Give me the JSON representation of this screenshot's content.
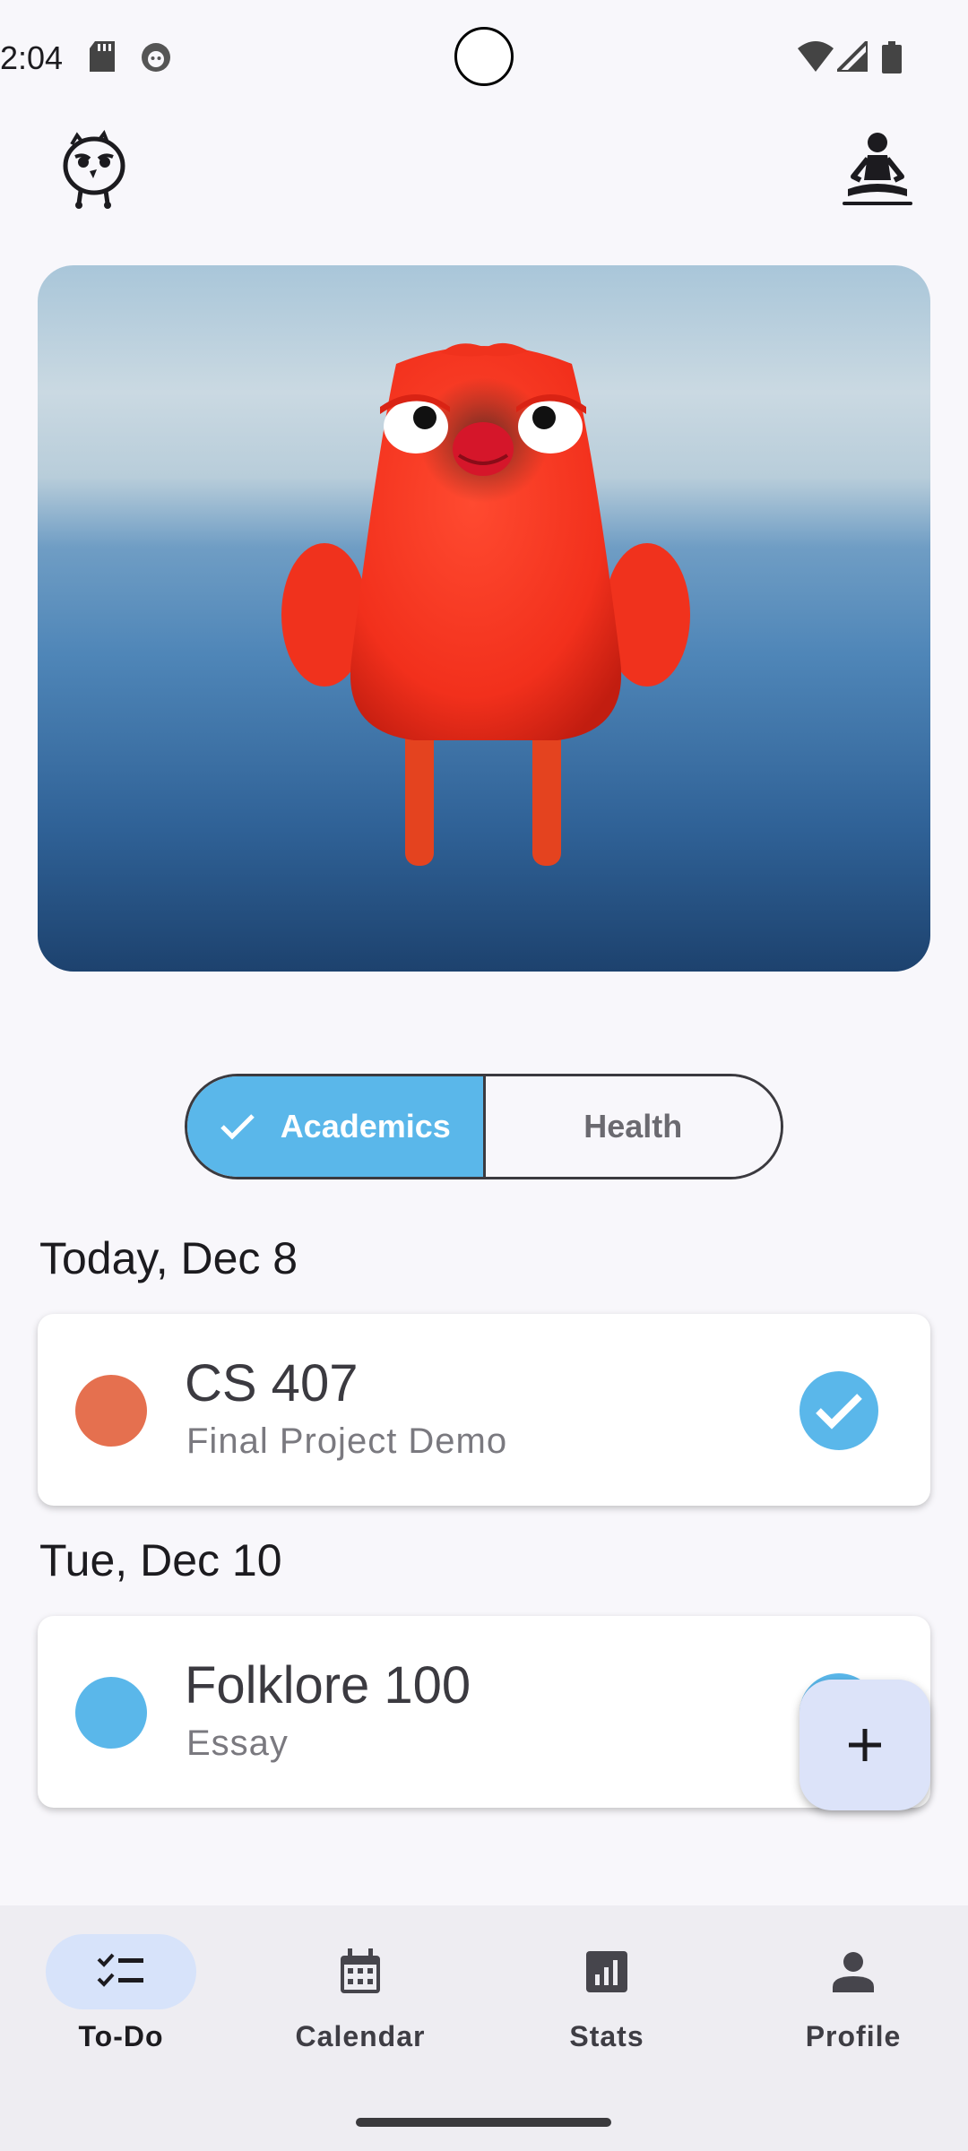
{
  "status_bar": {
    "time": "2:04",
    "icons": [
      "sd-card-icon",
      "notification-app-icon",
      "wifi-icon",
      "signal-icon",
      "battery-icon"
    ]
  },
  "top_bar": {
    "left_icon": "bird-mascot-icon",
    "right_icon": "meditation-icon"
  },
  "hero": {
    "image": "red-bird-3d-character"
  },
  "category_toggle": {
    "options": [
      {
        "label": "Academics",
        "selected": true
      },
      {
        "label": "Health",
        "selected": false
      }
    ]
  },
  "sections": [
    {
      "date": "Today, Dec 8",
      "tasks": [
        {
          "title": "CS 407",
          "subtitle": "Final Project Demo",
          "color": "#e5704f",
          "completed": true
        }
      ]
    },
    {
      "date": "Tue, Dec 10",
      "tasks": [
        {
          "title": "Folklore 100",
          "subtitle": "Essay",
          "color": "#5ab7ea",
          "completed": true
        }
      ]
    }
  ],
  "fab": {
    "icon": "plus-icon"
  },
  "bottom_nav": {
    "items": [
      {
        "label": "To-Do",
        "icon": "checklist-icon",
        "active": true
      },
      {
        "label": "Calendar",
        "icon": "calendar-icon",
        "active": false
      },
      {
        "label": "Stats",
        "icon": "bar-chart-icon",
        "active": false
      },
      {
        "label": "Profile",
        "icon": "person-icon",
        "active": false
      }
    ]
  },
  "colors": {
    "accent": "#5ab7ea",
    "background": "#f8f7fb",
    "nav_background": "#eeedf2",
    "fab_background": "#dce3f9"
  }
}
